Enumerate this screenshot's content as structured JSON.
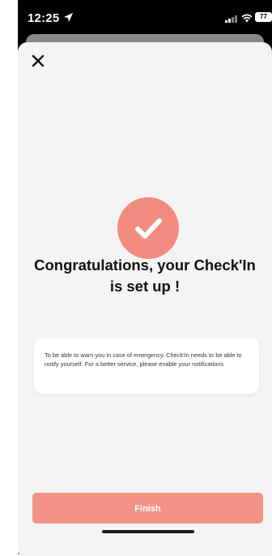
{
  "status_bar": {
    "time": "12:25",
    "battery": "77"
  },
  "icons": {
    "location": "location-arrow-icon",
    "signal": "signal-icon",
    "wifi": "wifi-icon",
    "battery": "battery-icon",
    "close": "close-icon",
    "check": "checkmark-icon"
  },
  "main": {
    "title_line1": "Congratulations, your Check'In",
    "title_line2": "is set up !",
    "info_text": "To be able to warn you in case of emergency, Check'In needs to be able to notify yourself. For a better service, please enable your notifications",
    "finish_label": "Finish"
  },
  "colors": {
    "accent": "#f28c80",
    "button": "#f39387",
    "background": "#f4f4f4"
  }
}
